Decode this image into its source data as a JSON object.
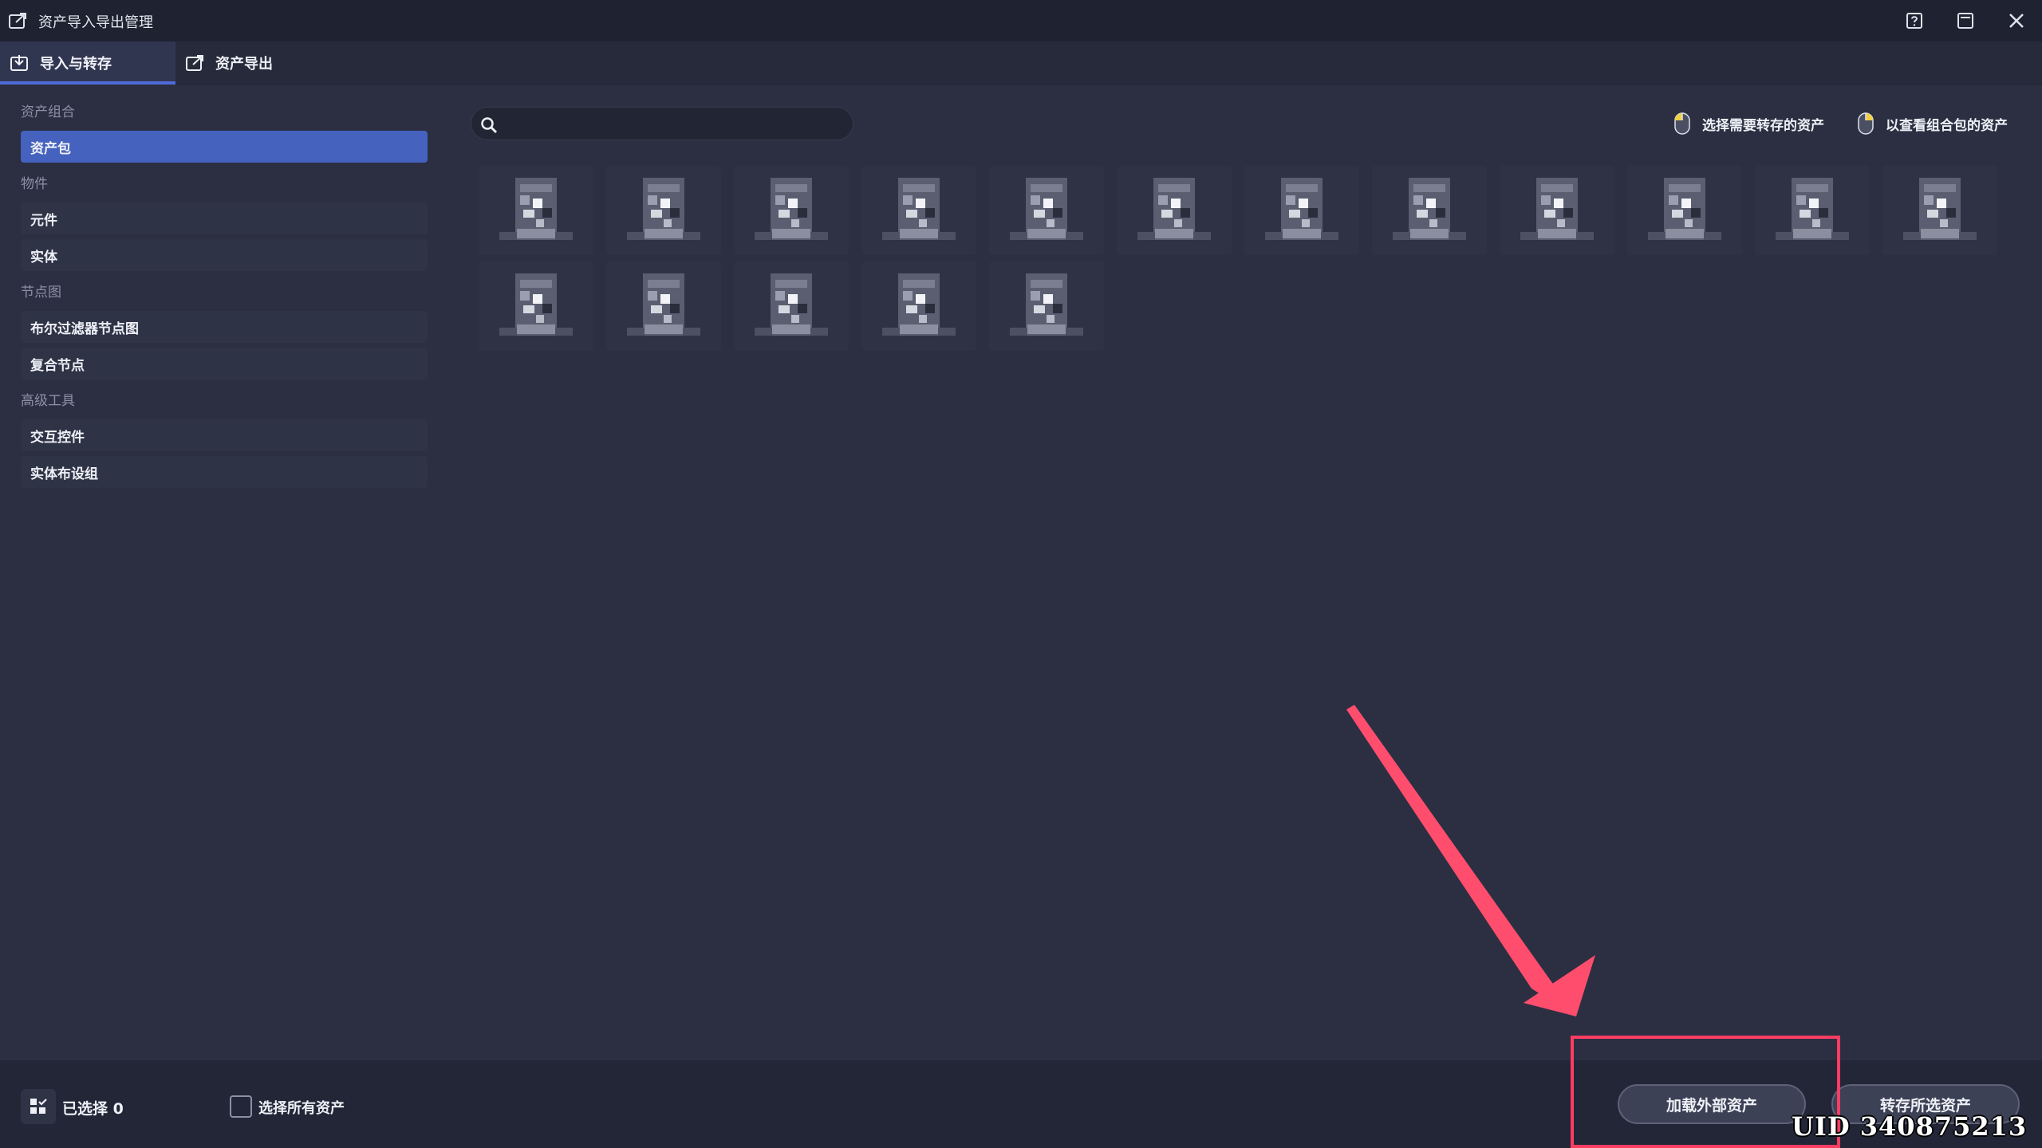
{
  "window": {
    "title": "资产导入导出管理",
    "icons": {
      "app": "export-icon",
      "help": "help-icon",
      "minimize": "minimize-icon",
      "close": "close-icon"
    }
  },
  "tabs": [
    {
      "label": "导入与转存",
      "icon": "import-icon",
      "active": true
    },
    {
      "label": "资产导出",
      "icon": "export-icon",
      "active": false
    }
  ],
  "sidebar": {
    "groups": [
      {
        "label": "资产组合",
        "items": [
          {
            "label": "资产包",
            "selected": true
          }
        ]
      },
      {
        "label": "物件",
        "items": [
          {
            "label": "元件"
          },
          {
            "label": "实体"
          }
        ]
      },
      {
        "label": "节点图",
        "items": [
          {
            "label": "布尔过滤器节点图"
          },
          {
            "label": "复合节点"
          }
        ]
      },
      {
        "label": "高级工具",
        "items": [
          {
            "label": "交互控件"
          },
          {
            "label": "实体布设组"
          }
        ]
      }
    ]
  },
  "search": {
    "value": "",
    "placeholder": "",
    "icon": "search-icon"
  },
  "hints": [
    {
      "text": "选择需要转存的资产",
      "icon": "mouse-left-click-icon"
    },
    {
      "text": "以查看组合包的资产",
      "icon": "mouse-right-click-icon"
    }
  ],
  "assets": {
    "count": 17,
    "thumbnail_icon": "pixelated-asset-thumbnail"
  },
  "footer": {
    "selected_label": "已选择 0",
    "select_all_label": "选择所有资产",
    "select_all_checked": false,
    "load_external_label": "加载外部资产",
    "transfer_selected_label": "转存所选资产"
  },
  "overlay": {
    "uid_text": "UID  340875213",
    "highlight_color": "#ff3c62"
  },
  "colors": {
    "background": "#2b2f41",
    "titlebar": "#1f2230",
    "accent": "#4f6ad8",
    "selected_item": "#4562be"
  }
}
